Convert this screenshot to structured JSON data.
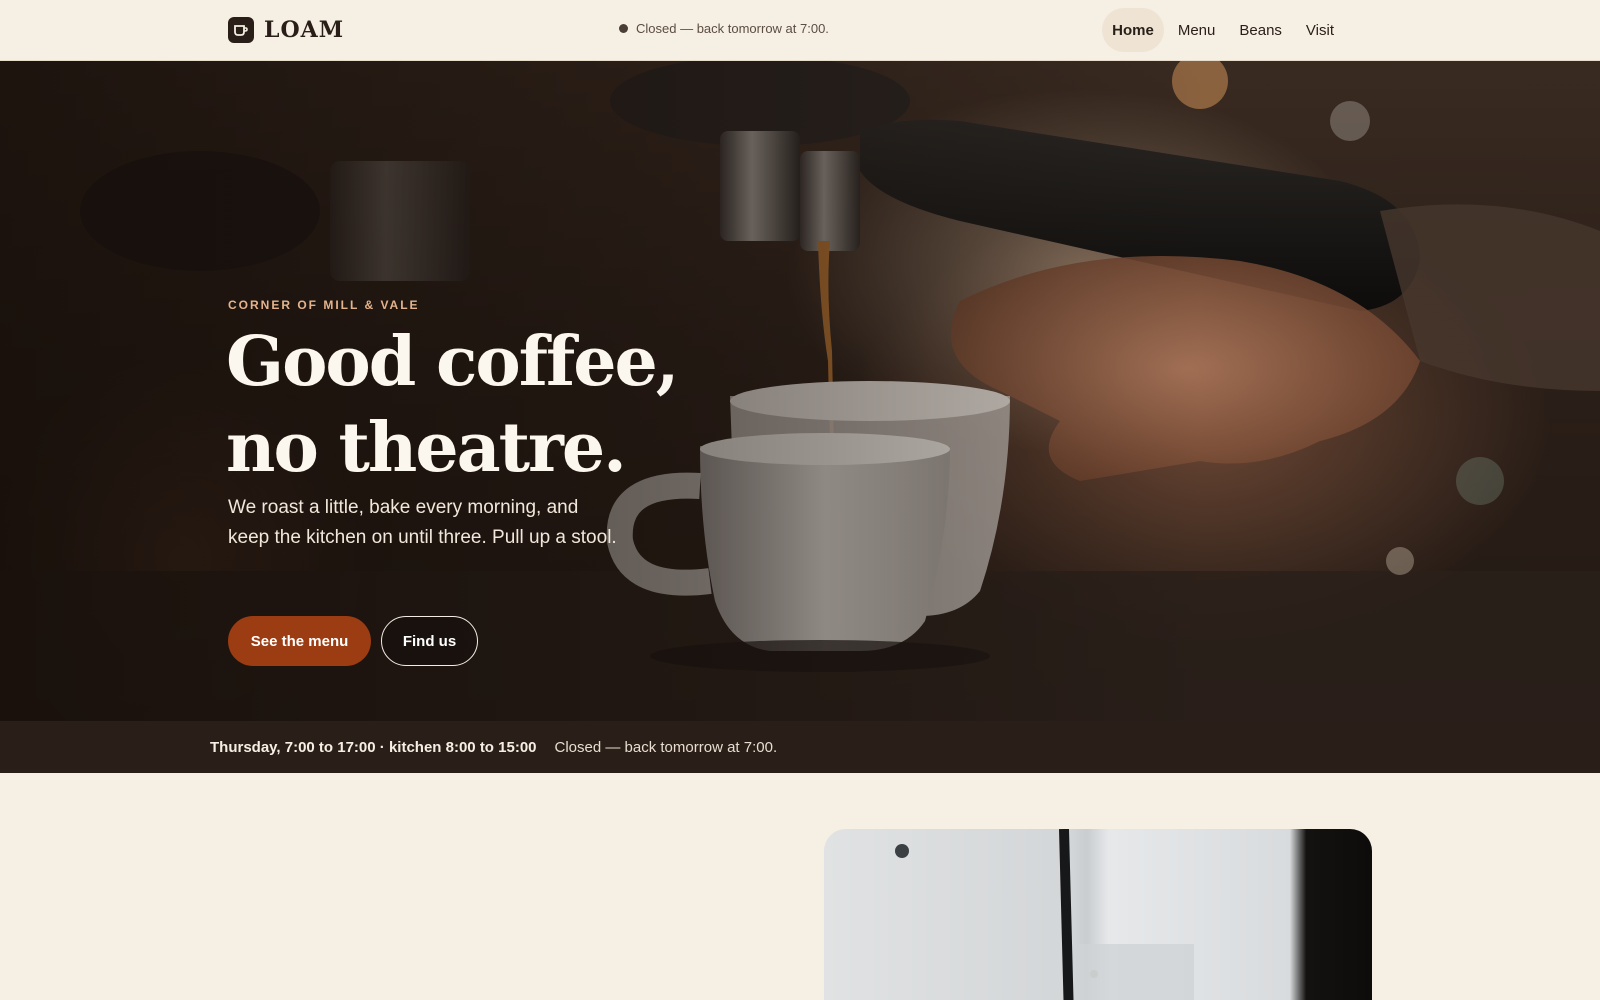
{
  "header": {
    "brand": "LOAM",
    "logo_icon": "coffee-cup-icon",
    "status_text": "Closed — back tomorrow at 7:00.",
    "nav": [
      {
        "label": "Home",
        "active": true
      },
      {
        "label": "Menu",
        "active": false
      },
      {
        "label": "Beans",
        "active": false
      },
      {
        "label": "Visit",
        "active": false
      }
    ]
  },
  "hero": {
    "eyebrow": "CORNER OF MILL & VALE",
    "headline_line1": "Good coffee,",
    "headline_line2": "no theatre.",
    "lede": "We roast a little, bake every morning, and keep the kitchen on until three. Pull up a stool.",
    "primary_cta": "See the menu",
    "secondary_cta": "Find us"
  },
  "hours": {
    "today": "Thursday, 7:00 to 17:00 · kitchen 8:00 to 15:00",
    "status": "Closed — back tomorrow at 7:00."
  },
  "colors": {
    "background": "#f6efe4",
    "ink": "#2a1f18",
    "accent": "#9c3c12",
    "eyebrow": "#e4b38c"
  }
}
